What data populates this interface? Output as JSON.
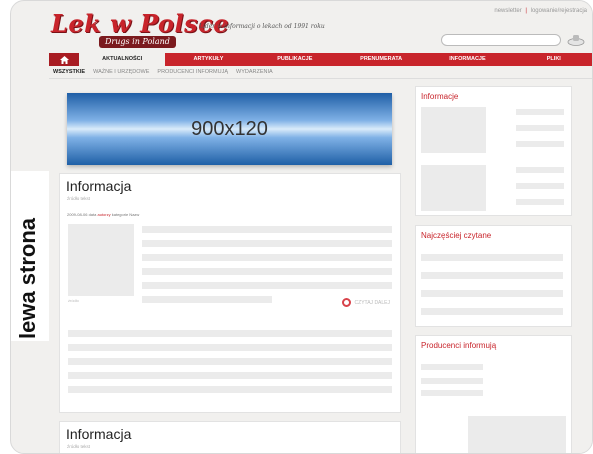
{
  "side_label": "lewa strona",
  "header": {
    "logo": "Lek w Polsce",
    "logo_sub": "Drugs in Poland",
    "tagline": "Lider w informacji o lekach od 1991 roku",
    "top_link_newsletter": "newsletter",
    "top_link_login": "logowanie/rejestracja",
    "search_placeholder": ""
  },
  "nav": {
    "items": [
      "AKTUALNOŚCI",
      "ARTYKUŁY",
      "PUBLIKACJE",
      "PRENUMERATA",
      "INFORMACJE",
      "PLIKI"
    ]
  },
  "subnav": {
    "items": [
      "WSZYSTKIE",
      "WAŻNE I URZĘDOWE",
      "PRODUCENCI INFORMUJĄ",
      "WYDARZENIA"
    ]
  },
  "banner": {
    "text": "900x120"
  },
  "article1": {
    "title": "Informacja",
    "source": "źródło tekst",
    "meta_prefix": "2009-08-06 data",
    "meta_highlight": "autorzy",
    "meta_suffix": "kategorie Nazw",
    "image_caption": "źródło",
    "readmore": "CZYTAJ DALEJ"
  },
  "article2": {
    "title": "Informacja",
    "source": "źródło tekst"
  },
  "sidebar": {
    "informacje_title": "Informacje",
    "popular_title": "Najczęściej czytane",
    "producers_title": "Producenci informują"
  },
  "colors": {
    "brand_red": "#c8242b",
    "background": "#f1f0ee",
    "placeholder": "#ebebeb"
  }
}
